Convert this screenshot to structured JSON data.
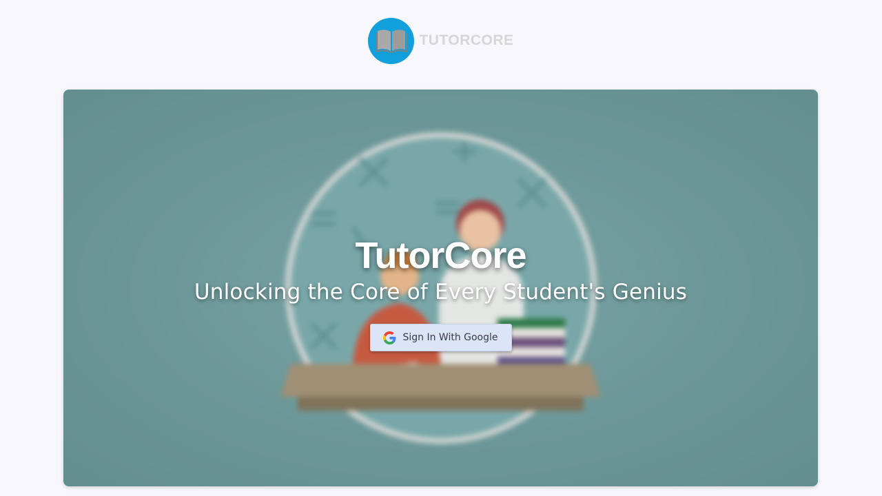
{
  "brand": {
    "name": "TUTORCORE",
    "logo_icon": "open-book-icon",
    "logo_color": "#12a0dc"
  },
  "hero": {
    "title": "TutorCore",
    "subtitle": "Unlocking the Core of Every Student's Genius",
    "background_color": "#6c9798",
    "illustration": "tutor-and-student-at-desk"
  },
  "signin": {
    "label": "Sign In With Google",
    "icon": "google-icon"
  }
}
